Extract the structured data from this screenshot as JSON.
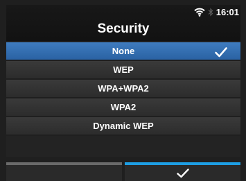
{
  "status": {
    "wifi_icon": "wifi-icon",
    "bluetooth_icon": "bluetooth-icon",
    "time": "16:01"
  },
  "header": {
    "title": "Security"
  },
  "menu": {
    "items": [
      {
        "label": "None",
        "selected": true
      },
      {
        "label": "WEP",
        "selected": false
      },
      {
        "label": "WPA+WPA2",
        "selected": false
      },
      {
        "label": "WPA2",
        "selected": false
      },
      {
        "label": "Dynamic WEP",
        "selected": false
      }
    ]
  },
  "softkeys": {
    "left": {
      "icon": "",
      "accent": "#6a6a6a"
    },
    "right": {
      "icon": "checkmark-icon",
      "accent": "#1e9ee3"
    }
  },
  "colors": {
    "selected_row": "#2f6db2",
    "row": "#333333",
    "background": "#1f1f1f"
  }
}
